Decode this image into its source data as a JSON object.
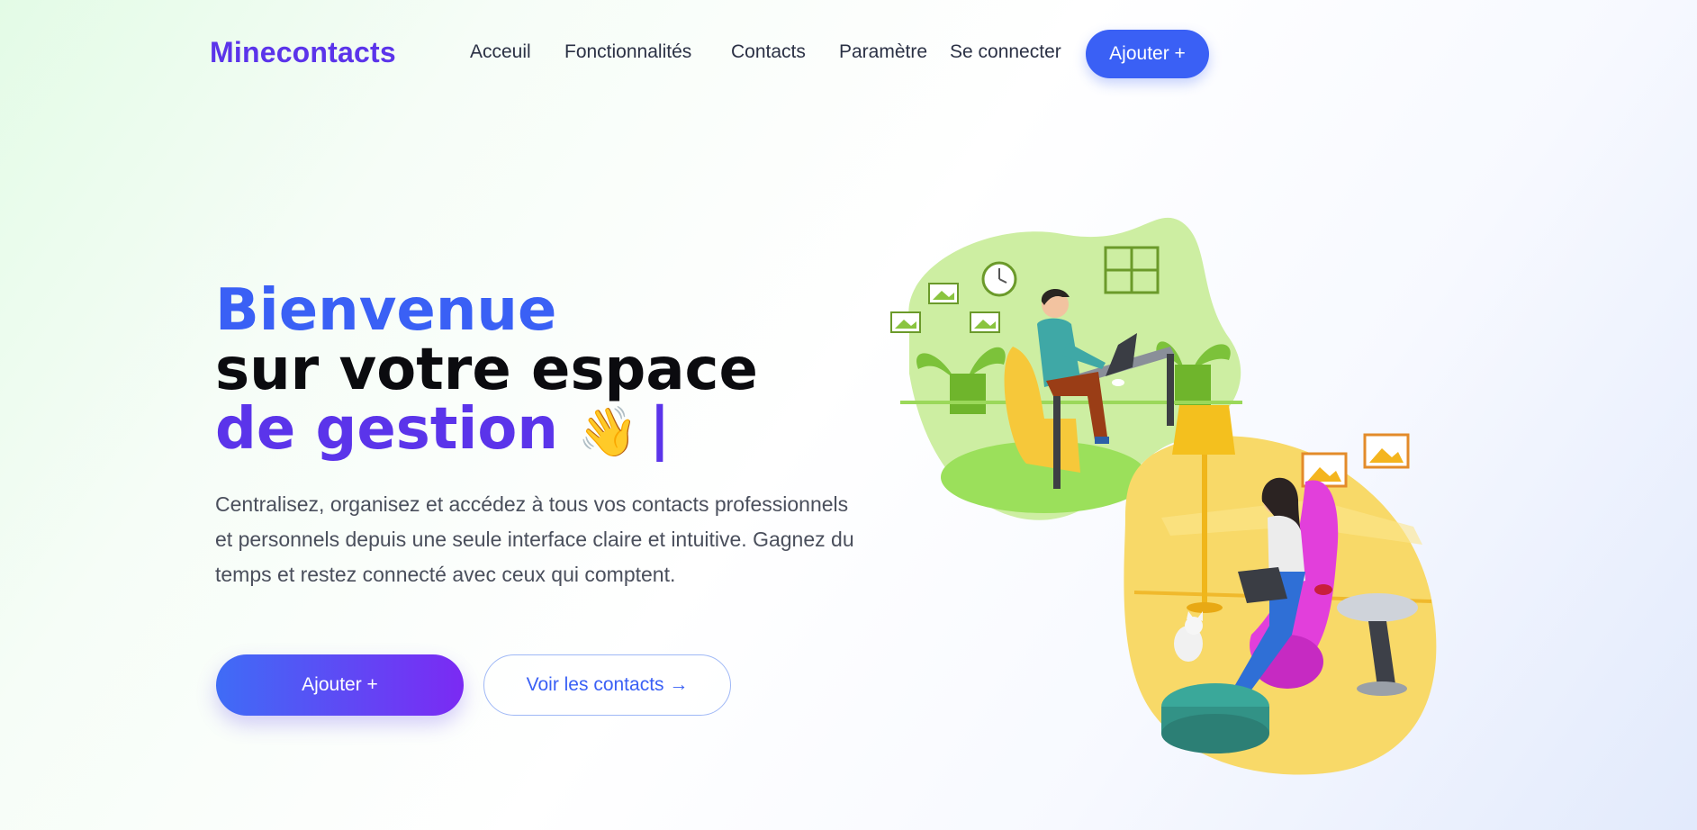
{
  "brand": {
    "name": "Minecontacts"
  },
  "nav": {
    "links": [
      "Acceuil",
      "Fonctionnalités",
      "Contacts",
      "Paramètre",
      "Se connecter"
    ],
    "cta": "Ajouter +"
  },
  "hero": {
    "line1": "Bienvenue",
    "line2": "sur votre espace",
    "line3": "de gestion",
    "emoji": "👋",
    "cursor": "|",
    "description": "Centralisez, organisez et accédez à tous vos contacts professionnels et personnels depuis une seule interface claire et intuitive. Gagnez du temps et restez connecté avec ceux qui comptent.",
    "primary_button": "Ajouter +",
    "secondary_button": "Voir les contacts →"
  },
  "colors": {
    "brand_purple": "#5b34ea",
    "primary_blue": "#3a60f5",
    "gradient_end": "#7b2af3"
  },
  "icons": {
    "illustration": "people-working-on-laptops-illustration",
    "wave": "waving-hand-icon"
  }
}
